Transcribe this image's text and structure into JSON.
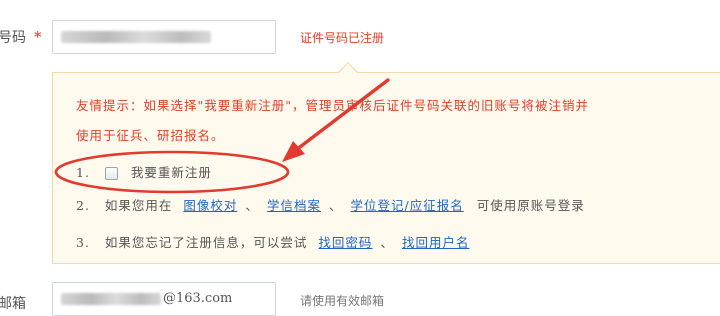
{
  "id_row": {
    "label_partial": "号码",
    "required_mark": "*",
    "hint": "证件号码已注册"
  },
  "tip": {
    "line1": "友情提示：如果选择\"我要重新注册\"，管理员审核后证件号码关联的旧账号将被注销并",
    "line2": "使用于征兵、研招报名。",
    "items": [
      {
        "num": "1.",
        "checkbox_label": "我要重新注册"
      },
      {
        "num": "2.",
        "prefix": "如果您用在",
        "links": [
          "图像校对",
          "学信档案",
          "学位登记/应征报名"
        ],
        "suffix": "可使用原账号登录"
      },
      {
        "num": "3.",
        "prefix": "如果您忘记了注册信息，可以尝试",
        "links": [
          "找回密码",
          "找回用户名"
        ]
      }
    ]
  },
  "email_row": {
    "label_partial": "邮箱",
    "value_suffix": "@163.com",
    "hint": "请使用有效邮箱"
  },
  "colors": {
    "annotation_red": "#e23a2e",
    "link_blue": "#1e66c4",
    "tip_bg": "#fff9ee"
  }
}
